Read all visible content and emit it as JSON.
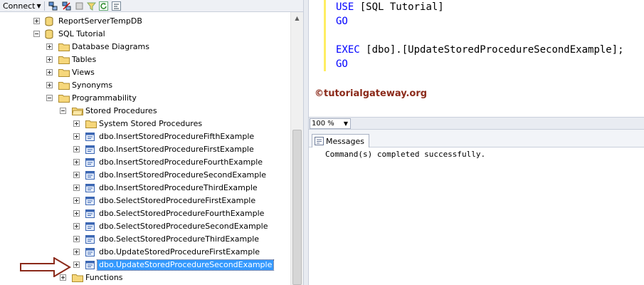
{
  "toolbar": {
    "connect_label": "Connect",
    "icons": [
      "connect-icon",
      "disconnect-icon",
      "stop-icon",
      "filter-icon",
      "refresh-icon",
      "collapse-icon"
    ]
  },
  "tree": {
    "nodes": [
      {
        "label": "ReportServerTempDB",
        "icon": "database-icon",
        "expander": "plus"
      },
      {
        "label": "SQL Tutorial",
        "icon": "database-icon",
        "expander": "minus"
      },
      {
        "label": "Database Diagrams",
        "icon": "folder-icon",
        "expander": "plus"
      },
      {
        "label": "Tables",
        "icon": "folder-icon",
        "expander": "plus"
      },
      {
        "label": "Views",
        "icon": "folder-icon",
        "expander": "plus"
      },
      {
        "label": "Synonyms",
        "icon": "folder-icon",
        "expander": "plus"
      },
      {
        "label": "Programmability",
        "icon": "folder-icon",
        "expander": "minus"
      },
      {
        "label": "Stored Procedures",
        "icon": "folder-icon",
        "expander": "minus"
      },
      {
        "label": "System Stored Procedures",
        "icon": "folder-icon",
        "expander": "plus"
      },
      {
        "label": "dbo.InsertStoredProcedureFifthExample",
        "icon": "stored-procedure-icon",
        "expander": "plus"
      },
      {
        "label": "dbo.InsertStoredProcedureFirstExample",
        "icon": "stored-procedure-icon",
        "expander": "plus"
      },
      {
        "label": "dbo.InsertStoredProcedureFourthExample",
        "icon": "stored-procedure-icon",
        "expander": "plus"
      },
      {
        "label": "dbo.InsertStoredProcedureSecondExample",
        "icon": "stored-procedure-icon",
        "expander": "plus"
      },
      {
        "label": "dbo.InsertStoredProcedureThirdExample",
        "icon": "stored-procedure-icon",
        "expander": "plus"
      },
      {
        "label": "dbo.SelectStoredProcedureFirstExample",
        "icon": "stored-procedure-icon",
        "expander": "plus"
      },
      {
        "label": "dbo.SelectStoredProcedureFourthExample",
        "icon": "stored-procedure-icon",
        "expander": "plus"
      },
      {
        "label": "dbo.SelectStoredProcedureSecondExample",
        "icon": "stored-procedure-icon",
        "expander": "plus"
      },
      {
        "label": "dbo.SelectStoredProcedureThirdExample",
        "icon": "stored-procedure-icon",
        "expander": "plus"
      },
      {
        "label": "dbo.UpdateStoredProcedureFirstExample",
        "icon": "stored-procedure-icon",
        "expander": "plus"
      },
      {
        "label": "dbo.UpdateStoredProcedureSecondExample",
        "icon": "stored-procedure-icon",
        "expander": "plus",
        "selected": true
      },
      {
        "label": "Functions",
        "icon": "folder-icon",
        "expander": "plus"
      }
    ]
  },
  "editor": {
    "line1_kw": "USE",
    "line1_rest": " [SQL Tutorial]",
    "line2_kw": "GO",
    "line3_kw": "EXEC",
    "line3_rest": " [dbo].[UpdateStoredProcedureSecondExample];",
    "line4_kw": "GO",
    "watermark": "©tutorialgateway.org"
  },
  "zoom": {
    "value": "100 %"
  },
  "results": {
    "tab_label": "Messages",
    "message": "Command(s) completed successfully."
  },
  "colors": {
    "keyword": "#0000ff",
    "selection": "#3399ff",
    "watermark": "#8b2a1a",
    "arrow": "#8b2a1a"
  }
}
